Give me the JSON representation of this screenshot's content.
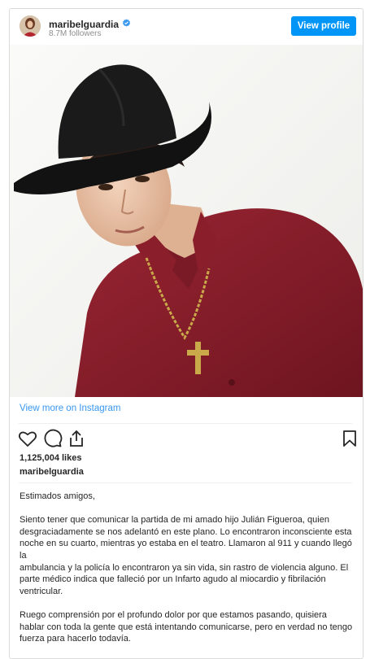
{
  "header": {
    "username": "maribelguardia",
    "followers": "8.7M followers",
    "view_profile_label": "View profile"
  },
  "icons": {
    "verified": "verified-badge-icon",
    "like": "heart-icon",
    "comment": "comment-icon",
    "share": "share-icon",
    "save": "bookmark-icon"
  },
  "colors": {
    "accent": "#0095f6",
    "link": "#3897f0",
    "shirt": "#8b1f2b",
    "hat": "#111111"
  },
  "view_more_label": "View more on Instagram",
  "post": {
    "likes": "1,125,004 likes",
    "username": "maribelguardia",
    "caption": [
      "Estimados amigos,",
      "Siento tener que comunicar la partida de mi amado hijo Julián Figueroa, quien desgraciadamente se nos adelantó en este plano. Lo encontraron inconsciente esta noche en su cuarto, mientras yo estaba en el teatro. Llamaron al 911 y cuando llegó la\nambulancia y la policía lo encontraron ya sin vida, sin rastro de violencia alguno. El parte médico indica que falleció por un Infarto agudo al miocardio y fibrilación ventricular.",
      "Ruego comprensión por el profundo dolor por que estamos pasando, quisiera hablar con toda la gente que está intentando comunicarse, pero en verdad no tengo fuerza para hacerlo todavía."
    ]
  }
}
